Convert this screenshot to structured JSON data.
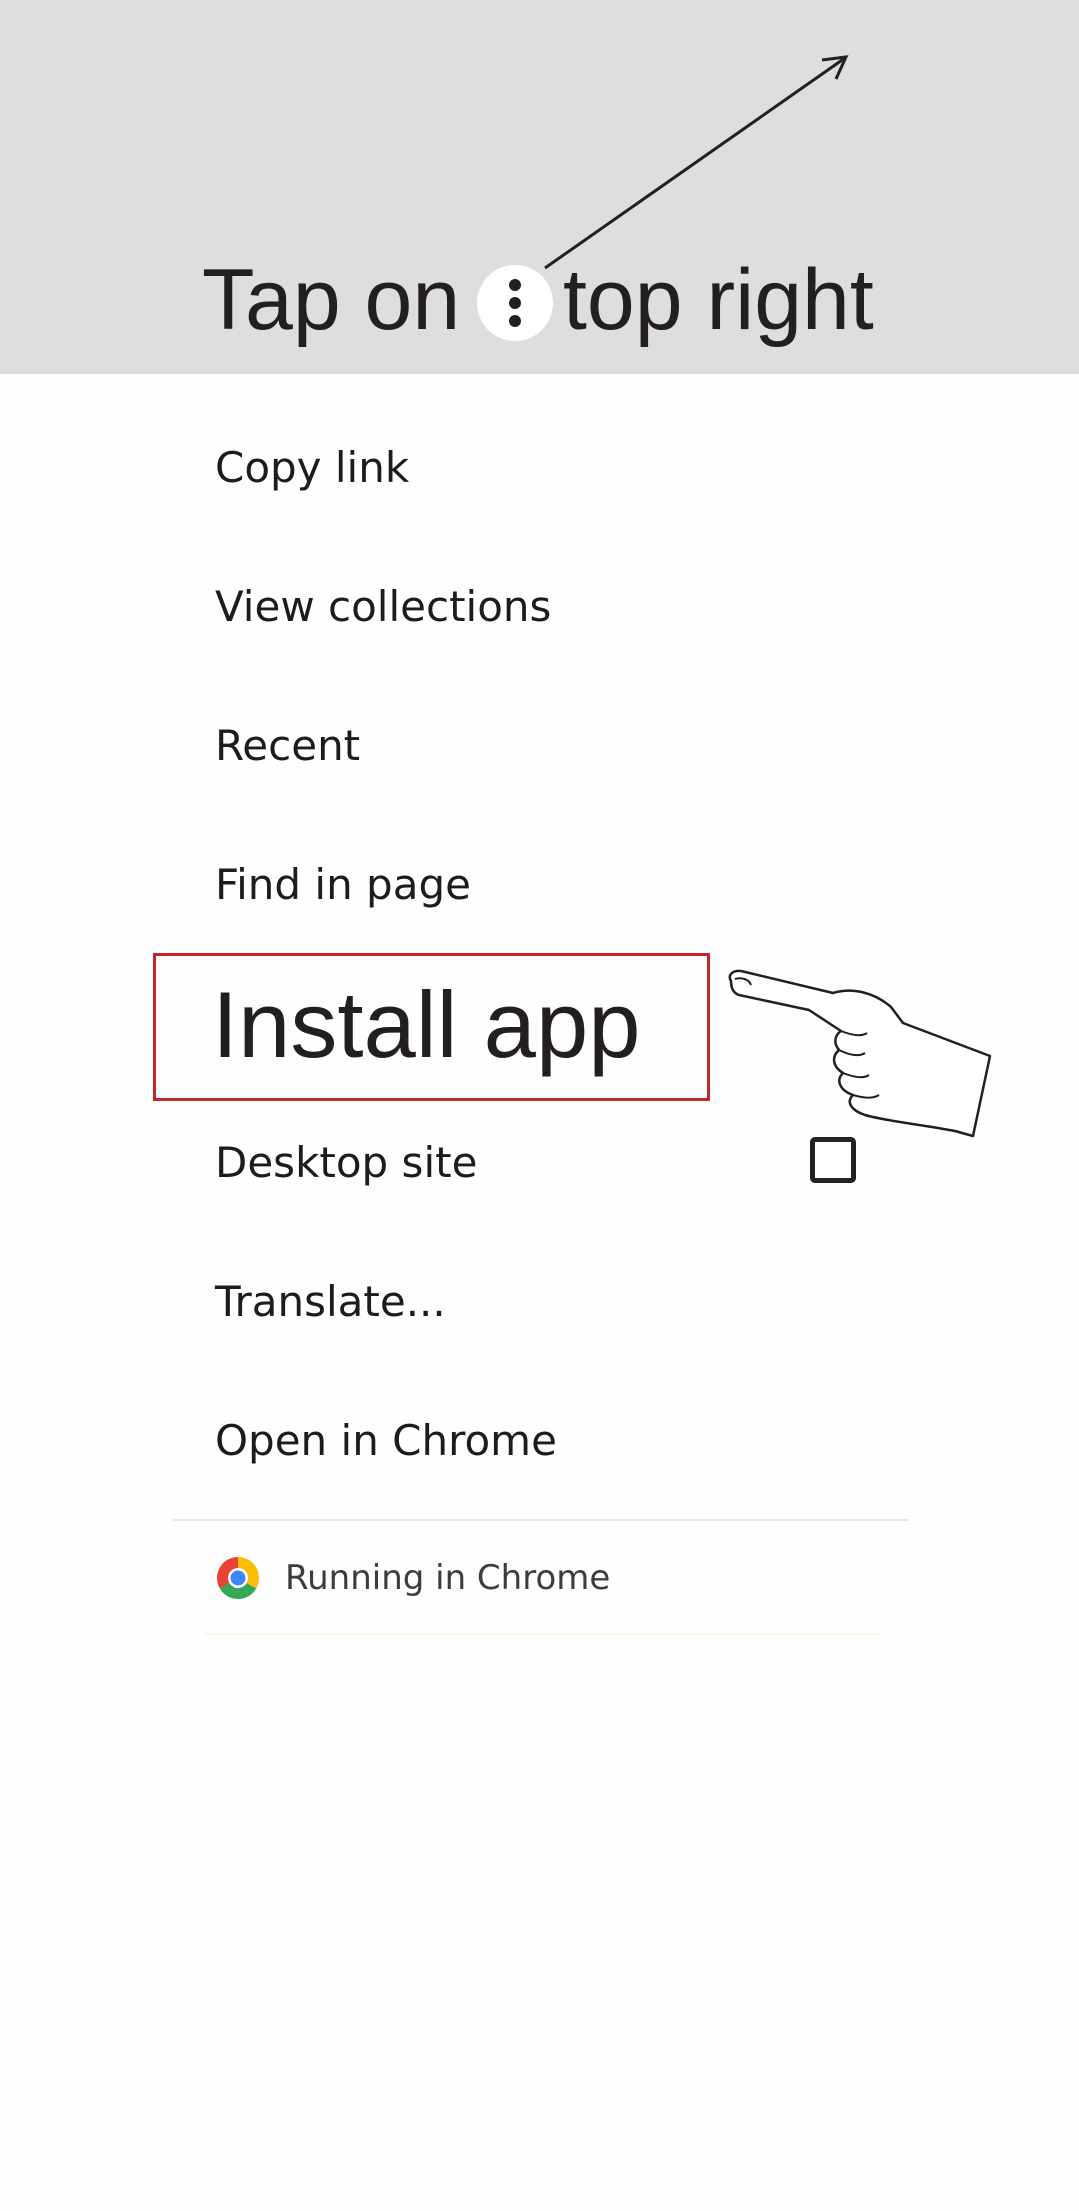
{
  "instruction": {
    "text_before": "Tap on",
    "text_after": "top right",
    "menu_icon": "more-vert-icon"
  },
  "menu": {
    "items": [
      {
        "label": "Copy link"
      },
      {
        "label": "View collections"
      },
      {
        "label": "Recent"
      },
      {
        "label": "Find in page"
      },
      {
        "label": "Install app",
        "highlighted": true
      },
      {
        "label": "Desktop site",
        "checkbox": true,
        "checked": false
      },
      {
        "label": "Translate..."
      },
      {
        "label": "Open in Chrome"
      }
    ],
    "footer": {
      "icon": "chrome-icon",
      "label": "Running in Chrome"
    }
  },
  "colors": {
    "banner_bg": "#dededd",
    "highlight_border": "#c0272d",
    "text": "#1c1c1c"
  }
}
